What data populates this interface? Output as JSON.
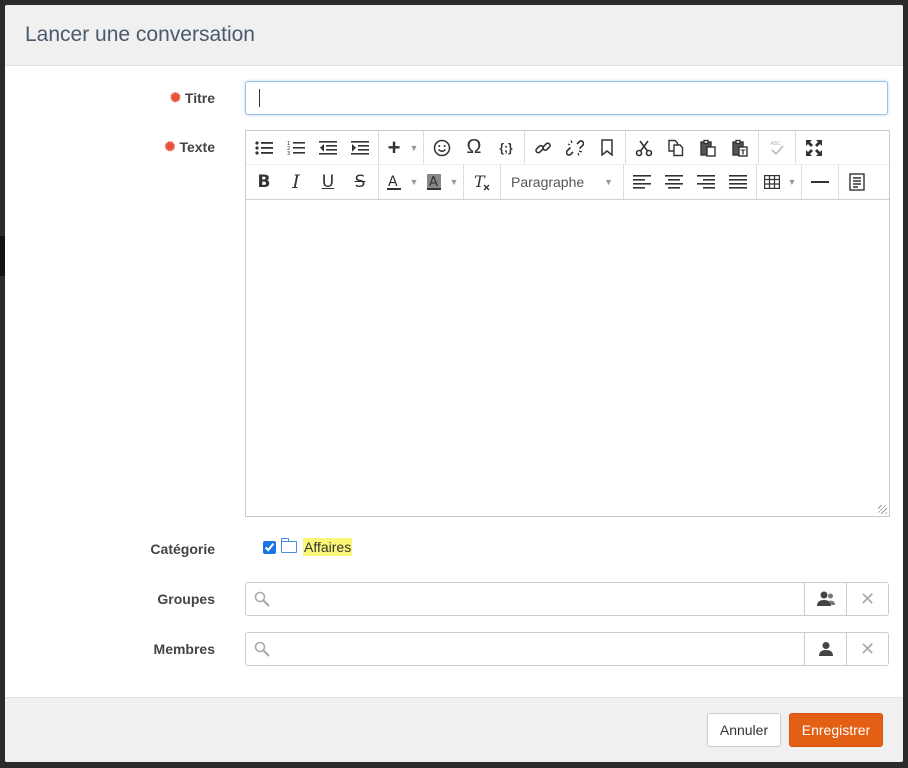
{
  "modal": {
    "title": "Lancer une conversation"
  },
  "form": {
    "titre": {
      "label": "Titre",
      "value": "",
      "required": true
    },
    "texte": {
      "label": "Texte",
      "required": true
    },
    "categorie": {
      "label": "Catégorie",
      "items": [
        {
          "name": "Affaires",
          "checked": true
        }
      ]
    },
    "groupes": {
      "label": "Groupes",
      "value": ""
    },
    "membres": {
      "label": "Membres",
      "value": ""
    }
  },
  "editor": {
    "format_select": "Paragraphe",
    "toolbar_row1": [
      "bullet-list",
      "numbered-list",
      "outdent",
      "indent",
      "insert",
      "emoji",
      "special-char",
      "code",
      "link",
      "unlink",
      "bookmark",
      "cut",
      "copy",
      "paste",
      "paste-text",
      "spellcheck",
      "fullscreen"
    ],
    "toolbar_row2": [
      "bold",
      "italic",
      "underline",
      "strikethrough",
      "text-color",
      "background-color",
      "clear-format",
      "paragraph-format",
      "align-left",
      "align-center",
      "align-right",
      "justify",
      "table",
      "horizontal-rule",
      "source"
    ]
  },
  "footer": {
    "cancel_label": "Annuler",
    "save_label": "Enregistrer"
  },
  "colors": {
    "accent": "#e35f14",
    "required": "#e8523a",
    "highlight": "#fbf776"
  }
}
